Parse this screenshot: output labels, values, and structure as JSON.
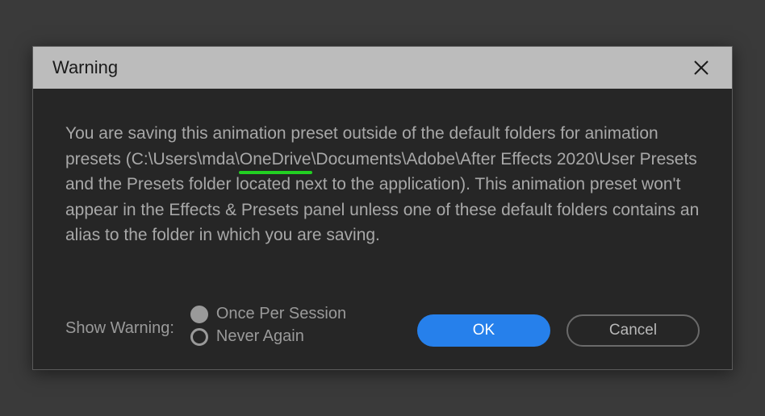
{
  "dialog": {
    "title": "Warning",
    "messageParts": {
      "before": "You are saving this animation preset outside of the default folders for animation presets (C:\\Users\\mda\\",
      "highlighted": "OneDrive",
      "after": "\\Documents\\Adobe\\After Effects 2020\\User Presets and the Presets folder located next to the application). This animation preset won't appear in the Effects & Presets panel unless one of these default folders contains an alias to the folder in which you are saving."
    },
    "showWarningLabel": "Show Warning:",
    "radioOptions": {
      "oncePerSession": "Once Per Session",
      "neverAgain": "Never Again"
    },
    "selectedRadio": "oncePerSession",
    "buttons": {
      "ok": "OK",
      "cancel": "Cancel"
    },
    "highlightColor": "#22d022",
    "primaryButtonColor": "#2680eb"
  }
}
